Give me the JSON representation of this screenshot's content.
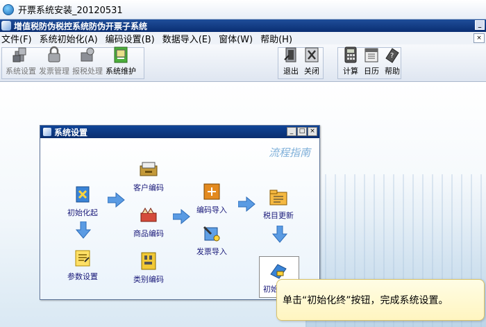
{
  "window": {
    "title": "开票系统安装_20120531"
  },
  "app": {
    "title": "增值税防伪税控系统防伪开票子系统"
  },
  "menu": {
    "items": [
      "文件(F)",
      "系统初始化(A)",
      "编码设置(B)",
      "数据导入(E)",
      "窗体(W)",
      "帮助(H)"
    ]
  },
  "toolbar": {
    "left": [
      {
        "label": "系统设置",
        "icon": "settings-icon"
      },
      {
        "label": "发票管理",
        "icon": "lock-icon"
      },
      {
        "label": "报税处理",
        "icon": "tax-report-icon"
      },
      {
        "label": "系统维护",
        "icon": "maintenance-icon"
      }
    ],
    "mid": [
      {
        "label": "退出",
        "icon": "exit-icon"
      },
      {
        "label": "关闭",
        "icon": "close-icon"
      }
    ],
    "right": [
      {
        "label": "计算",
        "icon": "calculator-icon"
      },
      {
        "label": "日历",
        "icon": "calendar-icon"
      },
      {
        "label": "帮助",
        "icon": "help-icon"
      }
    ]
  },
  "dialog": {
    "title": "系统设置",
    "flow_title": "流程指南",
    "nodes": {
      "init_start": "初始化起",
      "params": "参数设置",
      "customer_code": "客户编码",
      "product_code": "商品编码",
      "category_code": "类别编码",
      "code_import": "编码导入",
      "invoice_import": "发票导入",
      "tax_update": "税目更新",
      "init_end": "初始化终"
    }
  },
  "tooltip": {
    "text": "单击“初始化终”按钮，完成系统设置。"
  }
}
